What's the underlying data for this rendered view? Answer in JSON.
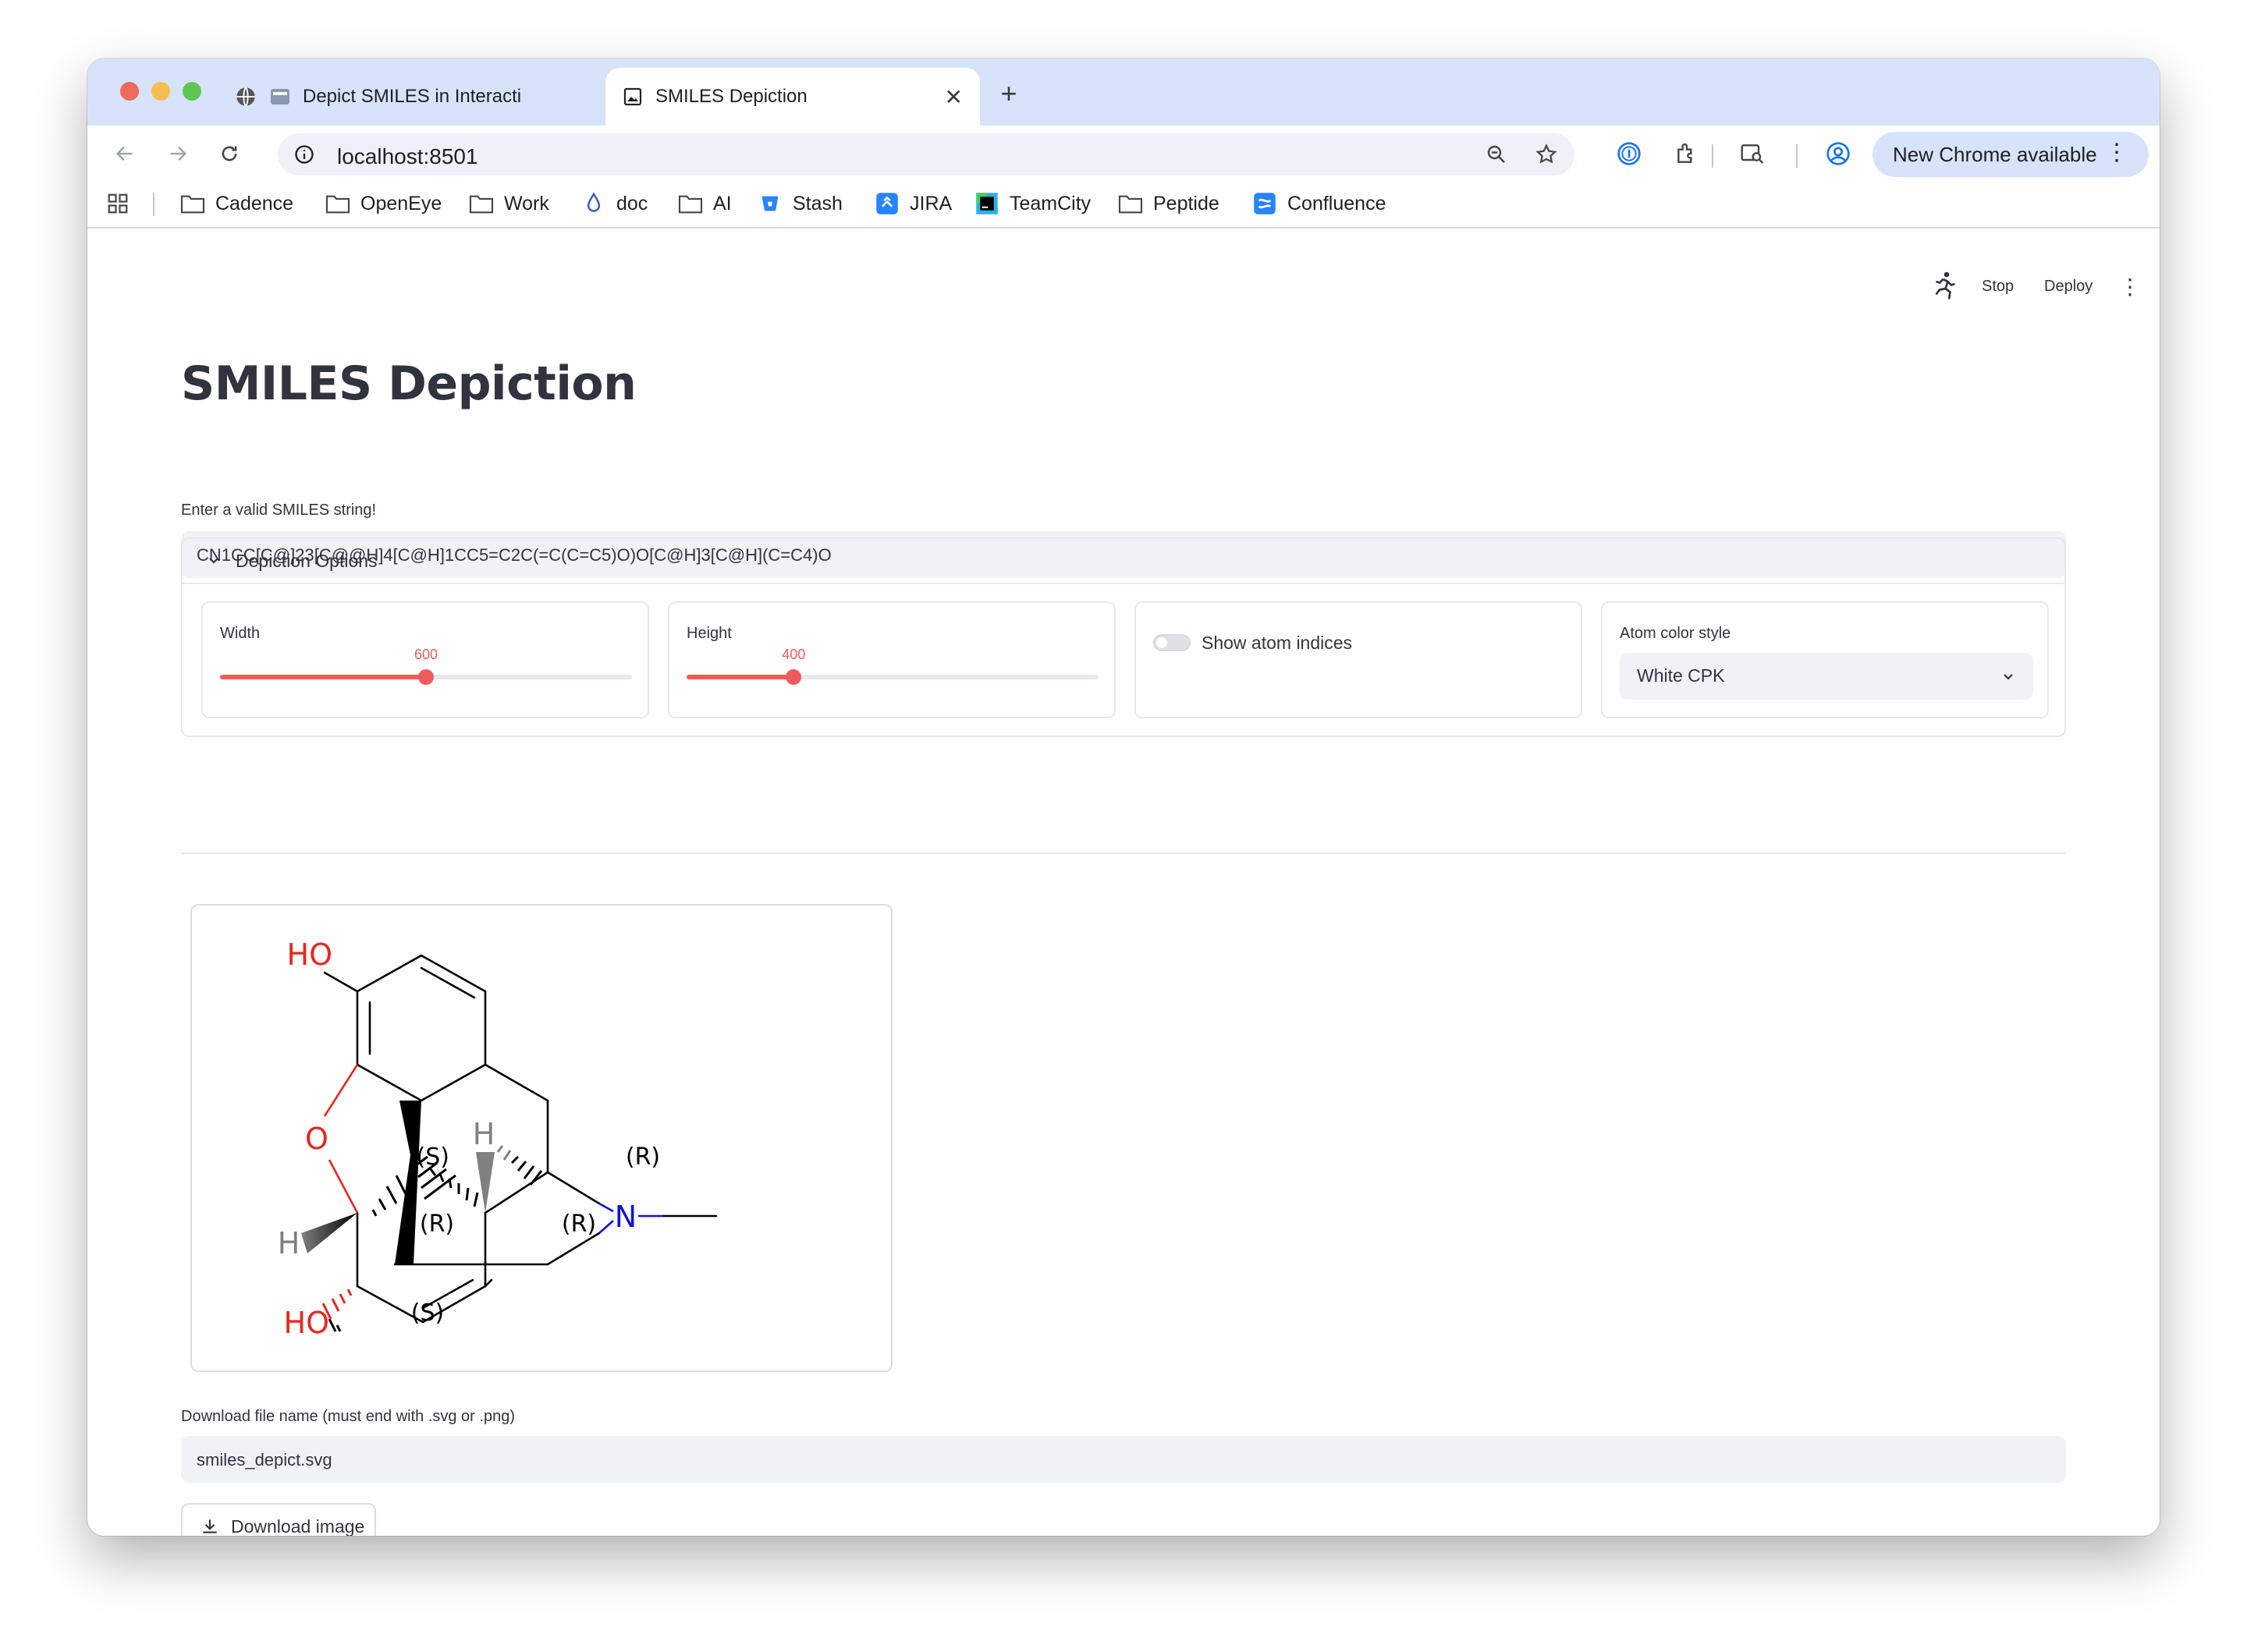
{
  "browser": {
    "tabs": [
      {
        "label": "Depict SMILES in Interacti",
        "active": false
      },
      {
        "label": "SMILES Depiction",
        "active": true
      }
    ],
    "url": "localhost:8501",
    "update_button": "New Chrome available",
    "bookmarks": [
      "Cadence",
      "OpenEye",
      "Work",
      "doc",
      "AI",
      "Stash",
      "JIRA",
      "TeamCity",
      "Peptide",
      "Confluence"
    ]
  },
  "app_toolbar": {
    "stop_label": "Stop",
    "deploy_label": "Deploy"
  },
  "page": {
    "title": "SMILES Depiction",
    "smiles_label": "Enter a valid SMILES string!",
    "smiles_value": "CN1CC[C@]23[C@@H]4[C@H]1CC5=C2C(=C(C=C5)O)O[C@H]3[C@H](C=C4)O",
    "options": {
      "header": "Depiction Options",
      "width": {
        "label": "Width",
        "value": 600,
        "fraction": 0.5
      },
      "height": {
        "label": "Height",
        "value": 400,
        "fraction": 0.26
      },
      "toggle": {
        "label": "Show atom indices",
        "on": false
      },
      "color_style": {
        "label": "Atom color style",
        "value": "White CPK"
      }
    },
    "molecule": {
      "atom_labels": {
        "oh_top": "HO",
        "o_ring": "O",
        "h_left": "H",
        "oh_bottom": "HO",
        "h_top": "H",
        "n": "N"
      },
      "stereo_labels": {
        "s_center": "(S)",
        "r_left": "(R)",
        "r_mid": "(R)",
        "r_right": "(R)",
        "s_bottom": "(S)"
      },
      "colors": {
        "oxygen": "#e8271f",
        "nitrogen": "#1010e0",
        "hydrogen": "#808080",
        "bond": "#000000"
      }
    },
    "download_label": "Download file name (must end with .svg or .png)",
    "download_value": "smiles_depict.svg",
    "download_button": "Download image"
  },
  "colors": {
    "accent": "#ef5b5b",
    "tabstrip": "#d6e3fa",
    "input_bg": "#f0f2f6"
  }
}
